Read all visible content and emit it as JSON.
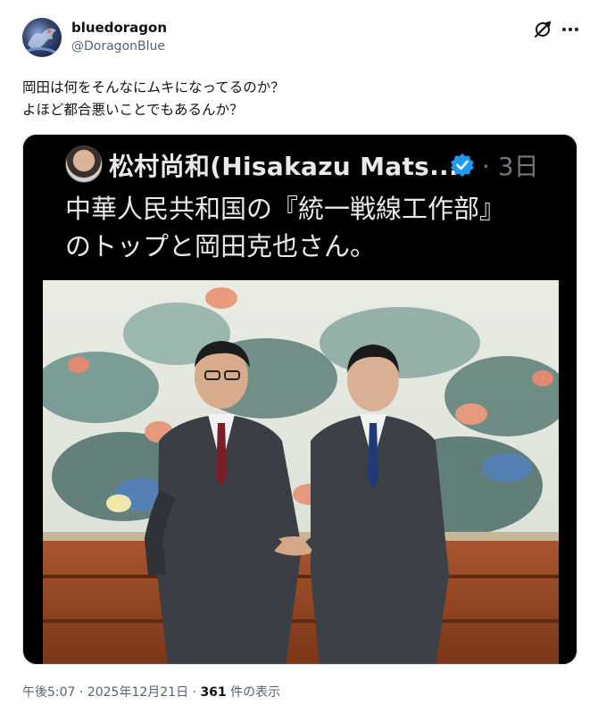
{
  "user": {
    "display_name": "bluedoragon",
    "handle": "@DoragonBlue",
    "avatar_icon": "dragon-avatar-icon"
  },
  "actions": {
    "grok_icon": "grok-icon",
    "more_icon": "more-icon"
  },
  "tweet": {
    "text": "岡田は何をそんなにムキになってるのか？\nよほど都合悪いことでもあるんか？"
  },
  "quoted_post": {
    "author": "松村尚和(Hisakazu Mats...",
    "verified_icon": "verified-badge-icon",
    "time": "· 3日",
    "text": "中華人民共和国の『統一戦線工作部』\nのトップと岡田克也さん。",
    "photo_description_icon": "photo-two-men-handshake"
  },
  "meta": {
    "time": "午後5:07",
    "separator1": " · ",
    "date": "2025年12月21日",
    "separator2": " · ",
    "views_count": "361",
    "views_label": " 件の表示"
  },
  "colors": {
    "text_primary": "#0f1419",
    "text_secondary": "#536471",
    "verified_blue": "#1d9bf0",
    "quote_bg": "#000000"
  }
}
